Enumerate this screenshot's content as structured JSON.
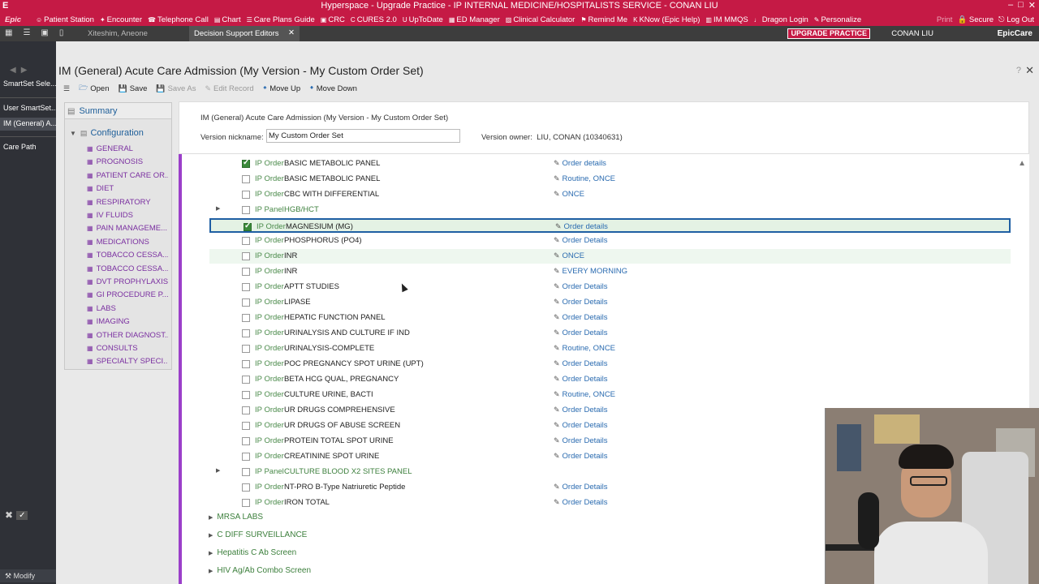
{
  "titlebar": {
    "app_letter": "E",
    "title": "Hyperspace - Upgrade Practice - IP INTERNAL MEDICINE/HOSPITALISTS  SERVICE - CONAN LIU"
  },
  "toolbar": {
    "logo": "Epic",
    "items": [
      {
        "icon": "person-icon",
        "label": "Patient Station"
      },
      {
        "icon": "encounter-icon",
        "label": "Encounter"
      },
      {
        "icon": "phone-icon",
        "label": "Telephone Call"
      },
      {
        "icon": "chart-icon",
        "label": "Chart"
      },
      {
        "icon": "care-plans-icon",
        "label": "Care Plans Guide"
      },
      {
        "icon": "crc-icon",
        "label": "CRC"
      },
      {
        "icon": "cures-icon",
        "label": "CURES 2.0"
      },
      {
        "icon": "uptodate-icon",
        "label": "UpToDate"
      },
      {
        "icon": "ed-manager-icon",
        "label": "ED Manager"
      },
      {
        "icon": "calculator-icon",
        "label": "Clinical Calculator"
      },
      {
        "icon": "remind-icon",
        "label": "Remind Me"
      },
      {
        "icon": "know-icon",
        "label": "KNow (Epic Help)"
      },
      {
        "icon": "mmqs-icon",
        "label": "IM MMQS"
      },
      {
        "icon": "mic-icon",
        "label": "Dragon Login"
      },
      {
        "icon": "personalize-icon",
        "label": "Personalize"
      }
    ],
    "right_items": [
      "Print",
      "Secure",
      "Log Out"
    ]
  },
  "tabbar": {
    "patient_tab": "Xiteshim, Aneone",
    "active_tab": "Decision Support Editors",
    "upgrade_badge": "UPGRADE PRACTICE",
    "user": "CONAN LIU",
    "brand": "EpicCare"
  },
  "leftnav": {
    "items": [
      {
        "label": "SmartSet Sele...",
        "selected": false
      },
      {
        "label": "User SmartSet...",
        "selected": false
      },
      {
        "label": "IM (General) A...",
        "selected": true
      },
      {
        "label": "Care Path",
        "selected": false
      }
    ],
    "modify": "Modify"
  },
  "editor": {
    "title": "IM (General) Acute Care Admission (My Version - My Custom Order Set)",
    "actions": [
      {
        "icon": "folder-icon",
        "label": "Open",
        "enabled": true
      },
      {
        "icon": "save-icon",
        "label": "Save",
        "enabled": true
      },
      {
        "icon": "save-as-icon",
        "label": "Save As",
        "enabled": false
      },
      {
        "icon": "edit-icon",
        "label": "Edit Record",
        "enabled": false
      },
      {
        "icon": "arrow-up-icon",
        "label": "Move Up",
        "enabled": true
      },
      {
        "icon": "arrow-down-icon",
        "label": "Move Down",
        "enabled": true
      }
    ]
  },
  "sidebar": {
    "summary": "Summary",
    "configuration": "Configuration",
    "items": [
      "GENERAL",
      "PROGNOSIS",
      "PATIENT CARE OR...",
      "DIET",
      "RESPIRATORY",
      "IV FLUIDS",
      "PAIN MANAGEME...",
      "MEDICATIONS",
      "TOBACCO CESSA...",
      "TOBACCO CESSA...",
      "DVT PROPHYLAXIS",
      "GI PROCEDURE P...",
      "LABS",
      "IMAGING",
      "OTHER DIAGNOST...",
      "CONSULTS",
      "SPECIALTY SPECI..."
    ]
  },
  "panel": {
    "title": "IM (General) Acute Care Admission (My Version - My Custom Order Set)",
    "nickname_label": "Version nickname:",
    "nickname_value": "My Custom Order Set",
    "owner_label": "Version owner:",
    "owner_value": "LIU, CONAN (10340631)"
  },
  "orders": [
    {
      "type": "IP Order",
      "name": "BASIC METABOLIC PANEL",
      "detail": "Order details",
      "checked": true,
      "expandable": false,
      "highlighted": false
    },
    {
      "type": "IP Order",
      "name": "BASIC METABOLIC PANEL",
      "detail": "Routine, ONCE",
      "checked": false,
      "expandable": false,
      "highlighted": false
    },
    {
      "type": "IP Order",
      "name": "CBC WITH DIFFERENTIAL",
      "detail": "ONCE",
      "checked": false,
      "expandable": false,
      "highlighted": false
    },
    {
      "type": "IP Panel",
      "name": "HGB/HCT",
      "detail": "",
      "checked": false,
      "expandable": true,
      "highlighted": false
    },
    {
      "type": "IP Order",
      "name": "MAGNESIUM (MG)",
      "detail": "Order details",
      "checked": true,
      "expandable": false,
      "highlighted": true
    },
    {
      "type": "IP Order",
      "name": "PHOSPHORUS (PO4)",
      "detail": "Order Details",
      "checked": false,
      "expandable": false,
      "highlighted": false
    },
    {
      "type": "IP Order",
      "name": "INR",
      "detail": "ONCE",
      "checked": false,
      "expandable": false,
      "highlighted": false
    },
    {
      "type": "IP Order",
      "name": "INR",
      "detail": "EVERY MORNING",
      "checked": false,
      "expandable": false,
      "highlighted": false
    },
    {
      "type": "IP Order",
      "name": "APTT STUDIES",
      "detail": "Order Details",
      "checked": false,
      "expandable": false,
      "highlighted": false
    },
    {
      "type": "IP Order",
      "name": "LIPASE",
      "detail": "Order Details",
      "checked": false,
      "expandable": false,
      "highlighted": false
    },
    {
      "type": "IP Order",
      "name": "HEPATIC FUNCTION PANEL",
      "detail": "Order Details",
      "checked": false,
      "expandable": false,
      "highlighted": false
    },
    {
      "type": "IP Order",
      "name": "URINALYSIS AND CULTURE IF IND",
      "detail": "Order Details",
      "checked": false,
      "expandable": false,
      "highlighted": false
    },
    {
      "type": "IP Order",
      "name": "URINALYSIS-COMPLETE",
      "detail": "Routine, ONCE",
      "checked": false,
      "expandable": false,
      "highlighted": false
    },
    {
      "type": "IP Order",
      "name": "POC PREGNANCY SPOT URINE (UPT)",
      "detail": "Order Details",
      "checked": false,
      "expandable": false,
      "highlighted": false
    },
    {
      "type": "IP Order",
      "name": "BETA HCG QUAL, PREGNANCY",
      "detail": "Order Details",
      "checked": false,
      "expandable": false,
      "highlighted": false
    },
    {
      "type": "IP Order",
      "name": "CULTURE URINE, BACTI",
      "detail": "Routine, ONCE",
      "checked": false,
      "expandable": false,
      "highlighted": false
    },
    {
      "type": "IP Order",
      "name": "UR DRUGS COMPREHENSIVE",
      "detail": "Order Details",
      "checked": false,
      "expandable": false,
      "highlighted": false
    },
    {
      "type": "IP Order",
      "name": "UR DRUGS OF ABUSE SCREEN",
      "detail": "Order Details",
      "checked": false,
      "expandable": false,
      "highlighted": false
    },
    {
      "type": "IP Order",
      "name": "PROTEIN TOTAL SPOT URINE",
      "detail": "Order Details",
      "checked": false,
      "expandable": false,
      "highlighted": false
    },
    {
      "type": "IP Order",
      "name": "CREATININE SPOT URINE",
      "detail": "Order Details",
      "checked": false,
      "expandable": false,
      "highlighted": false
    },
    {
      "type": "IP Panel",
      "name": "CULTURE BLOOD X2 SITES PANEL",
      "detail": "",
      "checked": false,
      "expandable": true,
      "highlighted": false
    },
    {
      "type": "IP Order",
      "name": "NT-PRO B-Type Natriuretic Peptide",
      "detail": "Order Details",
      "checked": false,
      "expandable": false,
      "highlighted": false
    },
    {
      "type": "IP Order",
      "name": "IRON TOTAL",
      "detail": "Order Details",
      "checked": false,
      "expandable": false,
      "highlighted": false
    }
  ],
  "groups": [
    "MRSA LABS",
    "C DIFF SURVEILLANCE",
    "Hepatitis C Ab Screen",
    "HIV Ag/Ab Combo Screen"
  ],
  "colors": {
    "epic_red": "#c51a45",
    "section_accent": "#9b3fc9",
    "link_blue": "#2a6bb0",
    "order_green": "#4a8a4a"
  }
}
